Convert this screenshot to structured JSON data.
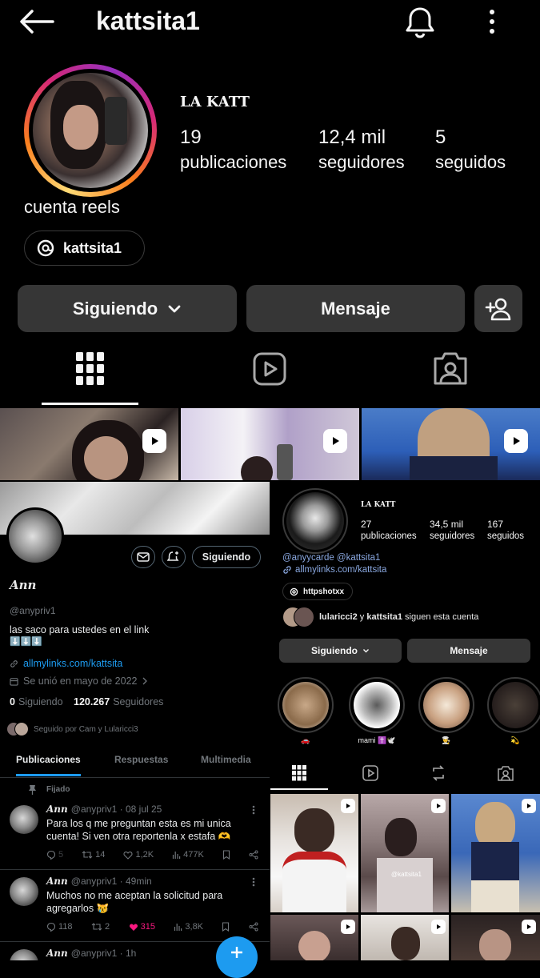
{
  "header": {
    "username": "kattsita1"
  },
  "profile": {
    "display_name": "LA KATT",
    "bio": "cuenta reels",
    "threads_handle": "kattsita1",
    "stats": [
      {
        "value": "19",
        "label": "publicaciones"
      },
      {
        "value": "12,4 mil",
        "label": "seguidores"
      },
      {
        "value": "5",
        "label": "seguidos"
      }
    ],
    "buttons": {
      "following": "Siguiendo",
      "message": "Mensaje"
    }
  },
  "twitter": {
    "name": "Ann",
    "handle": "@anypriv1",
    "bio": "las saco para ustedes en el link",
    "bio_emoji": "⬇️⬇️⬇️",
    "link": "allmylinks.com/kattsita",
    "joined": "Se unió en mayo de 2022",
    "following_count": "0",
    "following_label": "Siguiendo",
    "followers_count": "120.267",
    "followers_label": "Seguidores",
    "followed_by": "Seguido por Cam y Lularicci3",
    "follow_button": "Siguiendo",
    "tabs": [
      "Publicaciones",
      "Respuestas",
      "Multimedia"
    ],
    "pinned_label": "Fijado",
    "tweets": [
      {
        "name": "Ann",
        "meta": "@anypriv1 · 08 jul 25",
        "text": "Para los q me preguntan esta es mi unica cuenta! Si ven otra reportenla x estafa 🫶",
        "replies": "5",
        "retweets": "14",
        "likes": "1,2K",
        "views": "477K"
      },
      {
        "name": "Ann",
        "meta": "@anypriv1 · 49min",
        "text": "Muchos no me aceptan la solicitud para agregarlos 😿",
        "replies": "118",
        "retweets": "2",
        "likes": "315",
        "views": "3,8K"
      },
      {
        "name": "Ann",
        "meta": "@anypriv1 · 1h"
      }
    ]
  },
  "ig_inner": {
    "display_name": "LA KATT",
    "stats": [
      {
        "value": "27",
        "label": "publicaciones"
      },
      {
        "value": "34,5 mil",
        "label": "seguidores"
      },
      {
        "value": "167",
        "label": "seguidos"
      }
    ],
    "bio_line": "@anyycarde @kattsita1",
    "link": "allmylinks.com/kattsita",
    "threads": "httpshotxx",
    "followed_by_user1": "lularicci2",
    "followed_by_conj": " y ",
    "followed_by_user2": "kattsita1",
    "followed_by_suffix": " siguen esta cuenta",
    "following_button": "Siguiendo",
    "message_button": "Mensaje",
    "highlights": [
      "🚗",
      "mami ✝️🕊️",
      "👨‍🍳",
      "💫"
    ],
    "grid_caption": "@kattsita1"
  },
  "colors": {
    "accent_blue": "#1d9bf0",
    "button_gray": "#363636",
    "like_pink": "#f91880"
  }
}
